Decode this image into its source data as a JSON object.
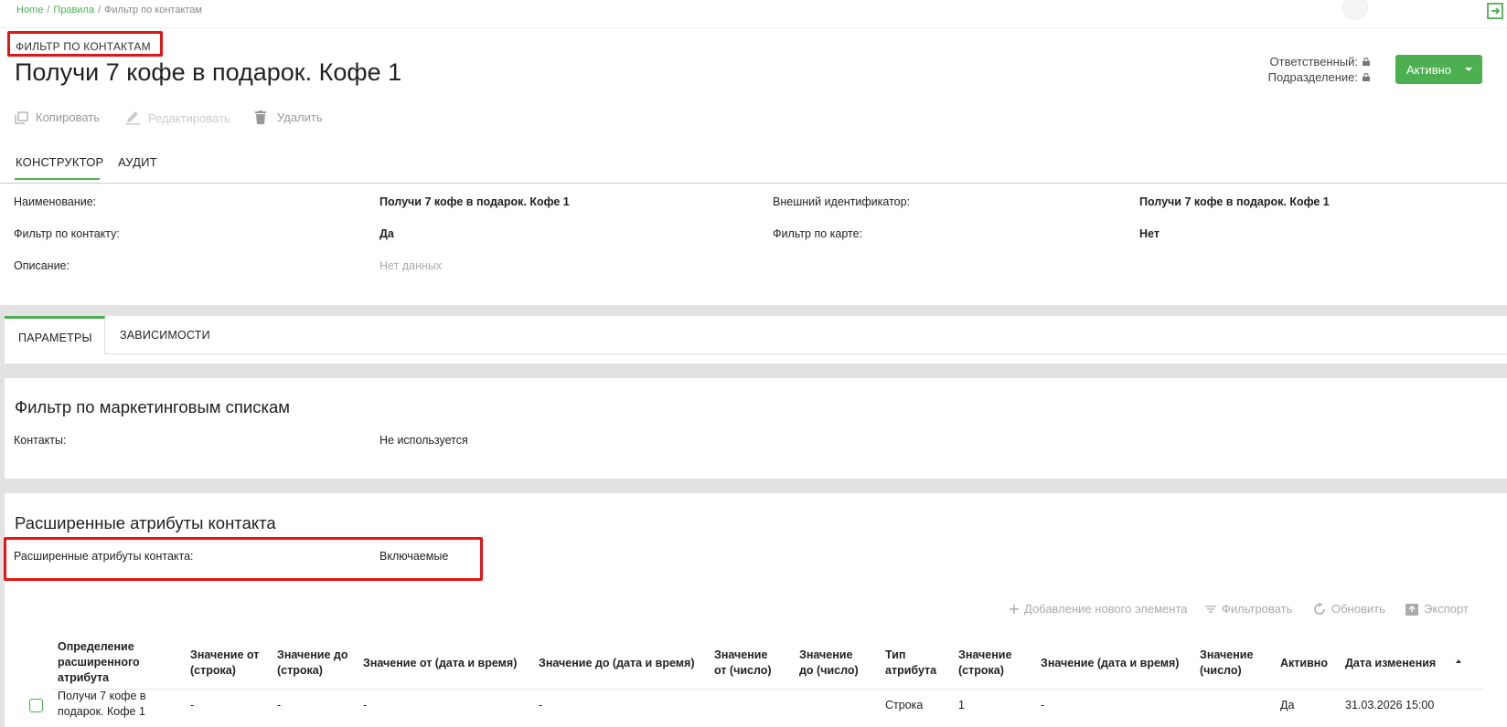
{
  "breadcrumb": {
    "home": "Home",
    "rules": "Правила",
    "current": "Фильтр по контактам"
  },
  "header": {
    "record_type": "ФИЛЬТР ПО КОНТАКТАМ",
    "title": "Получи 7 кофе в подарок. Кофе 1",
    "responsible_label": "Ответственный:",
    "division_label": "Подразделение:",
    "status": "Активно"
  },
  "toolbar": {
    "copy": "Копировать",
    "edit": "Редактировать",
    "delete": "Удалить"
  },
  "tabs": {
    "constructor": "КОНСТРУКТОР",
    "audit": "АУДИТ"
  },
  "fields": {
    "name_label": "Наименование:",
    "name_value": "Получи 7 кофе в подарок. Кофе 1",
    "external_id_label": "Внешний идентификатор:",
    "external_id_value": "Получи 7 кофе в подарок. Кофе 1",
    "contact_filter_label": "Фильтр по контакту:",
    "contact_filter_value": "Да",
    "card_filter_label": "Фильтр по карте:",
    "card_filter_value": "Нет",
    "description_label": "Описание:",
    "description_value": "Нет данных"
  },
  "subtabs": {
    "params": "ПАРАМЕТРЫ",
    "deps": "ЗАВИСИМОСТИ"
  },
  "marketing": {
    "title": "Фильтр по маркетинговым спискам",
    "contacts_label": "Контакты:",
    "contacts_value": "Не используется"
  },
  "ext_attrs": {
    "title": "Расширенные атрибуты контакта",
    "label": "Расширенные атрибуты контакта:",
    "value": "Включаемые"
  },
  "grid_toolbar": {
    "add": "Добавление нового элемента",
    "filter": "Фильтровать",
    "refresh": "Обновить",
    "export": "Экспорт"
  },
  "table": {
    "columns": [
      "Определение расширенного атрибута",
      "Значение от (строка)",
      "Значение до (строка)",
      "Значение от (дата и время)",
      "Значение до (дата и время)",
      "Значение от (число)",
      "Значение до (число)",
      "Тип атрибута",
      "Значение (строка)",
      "Значение (дата и время)",
      "Значение (число)",
      "Активно",
      "Дата изменения"
    ],
    "rows": [
      {
        "definition": "Получи 7 кофе в подарок. Кофе 1",
        "str_from": "-",
        "str_to": "-",
        "dt_from": "-",
        "dt_to": "-",
        "num_from": "",
        "num_to": "",
        "attr_type": "Строка",
        "str_value": "1",
        "dt_value": "-",
        "num_value": "",
        "active": "Да",
        "modified": "31.03.2026 15:00"
      }
    ]
  },
  "colors": {
    "accent": "#4caf50",
    "highlight": "#e31515"
  }
}
